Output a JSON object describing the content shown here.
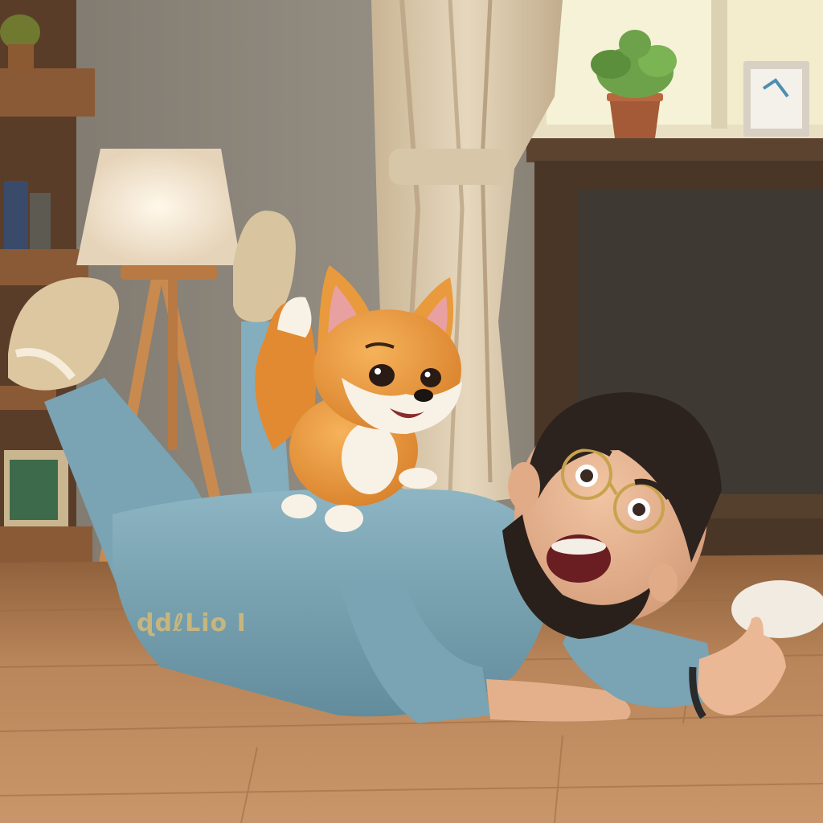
{
  "scene": {
    "pants_print_text": "ɖdℓLio I",
    "colors": {
      "wall": "#8e8a80",
      "floor": "#b98556",
      "sweater": "#7fa9b8",
      "fox_fur": "#e99a3c",
      "cabinet": "#4a3626",
      "curtain": "#d9c8ab",
      "lamp_shade": "#efe2cf",
      "window_light": "#f6f2d8",
      "plant": "#6da24a"
    }
  }
}
